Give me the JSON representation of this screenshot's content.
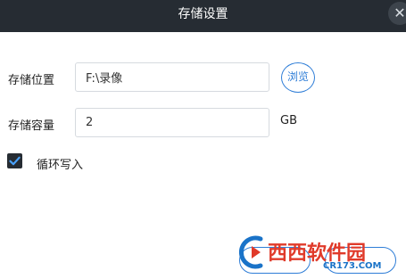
{
  "dialog": {
    "title": "存储设置",
    "close_glyph": "✕"
  },
  "form": {
    "location_label": "存储位置",
    "location_value": "F:\\录像",
    "browse_label": "浏览",
    "capacity_label": "存储容量",
    "capacity_value": "2",
    "capacity_unit": "GB",
    "loop_write_label": "循环写入",
    "loop_write_checked": true
  },
  "watermark": {
    "brand_cn": "西西软件园",
    "brand_url": "CR173.COM"
  },
  "colors": {
    "titlebar": "#262c33",
    "accent": "#2e7dd7",
    "watermark_red": "#e03a2a",
    "watermark_blue": "#1a73c8"
  }
}
